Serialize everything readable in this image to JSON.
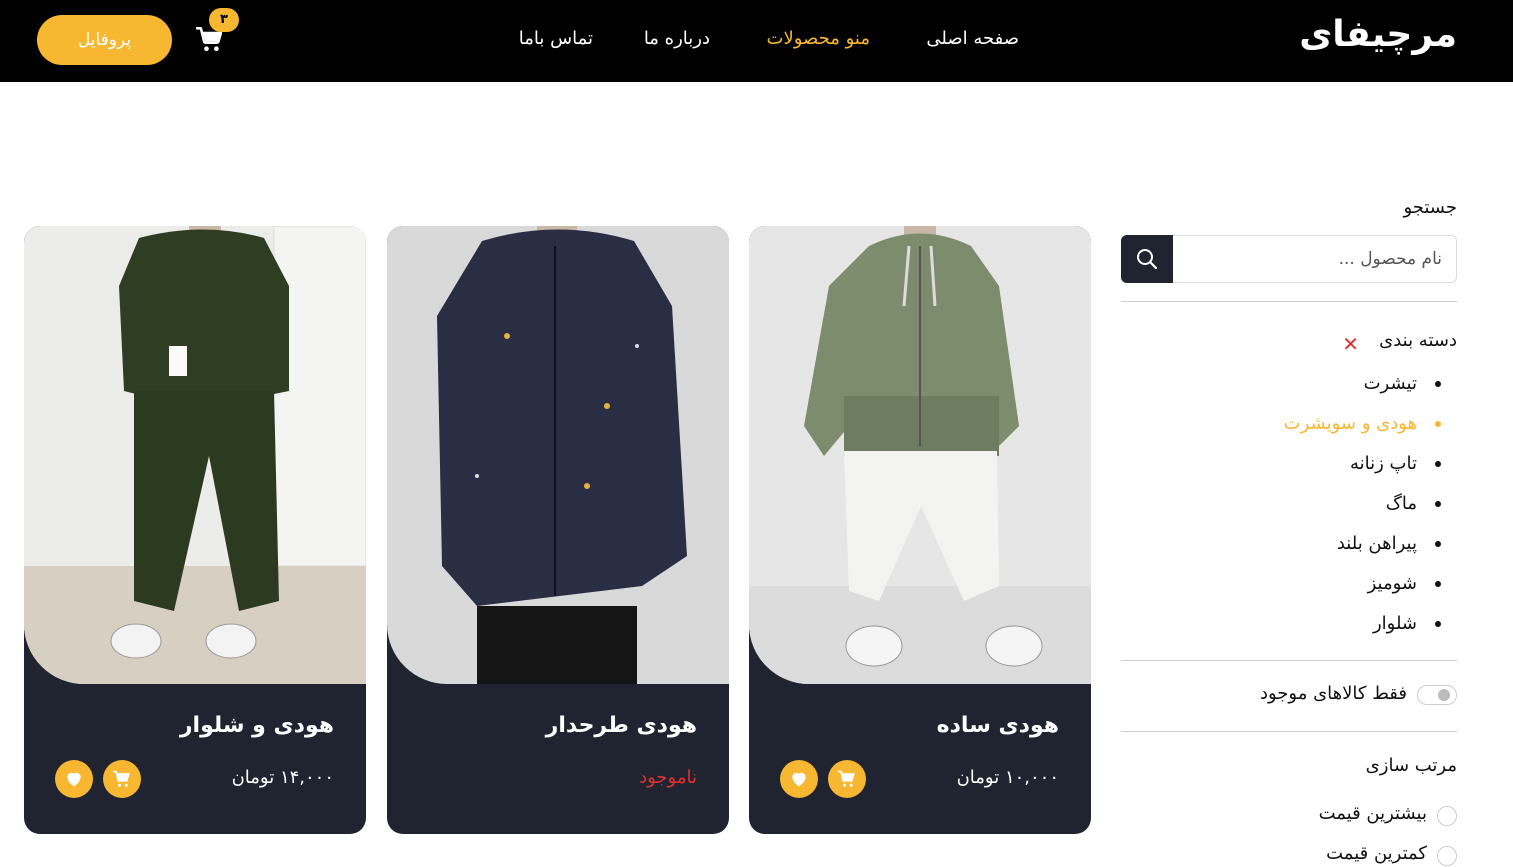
{
  "header": {
    "logo": "مرچیفای",
    "nav": {
      "home": "صفحه اصلی",
      "menu": "منو محصولات",
      "about": "درباره ما",
      "contact": "تماس باما"
    },
    "cart_count": "۳",
    "profile_label": "پروفایل",
    "accent_color": "#f7b731"
  },
  "sidebar": {
    "search_title": "جستجو",
    "search_placeholder": "نام محصول ...",
    "category_title": "دسته بندی",
    "categories": [
      "تیشرت",
      "هودی و سویشرت",
      "تاپ زنانه",
      "ماگ",
      "پیراهن بلند",
      "شومیز",
      "شلوار"
    ],
    "active_category": "هودی و سویشرت",
    "in_stock_label": "فقط کالاهای موجود",
    "sort_title": "مرتب سازی",
    "sort_options": [
      "بیشترین قیمت",
      "کمترین قیمت"
    ]
  },
  "products": [
    {
      "title": "هودی ساده",
      "price": "۱۰,۰۰۰ تومان",
      "in_stock": true
    },
    {
      "title": "هودی طرحدار",
      "price": "ناموجود",
      "in_stock": false
    },
    {
      "title": "هودی و شلوار",
      "price": "۱۴,۰۰۰ تومان",
      "in_stock": true
    }
  ],
  "icons": [
    "cart-icon",
    "search-icon",
    "close-icon",
    "heart-icon",
    "cart-add-icon"
  ]
}
